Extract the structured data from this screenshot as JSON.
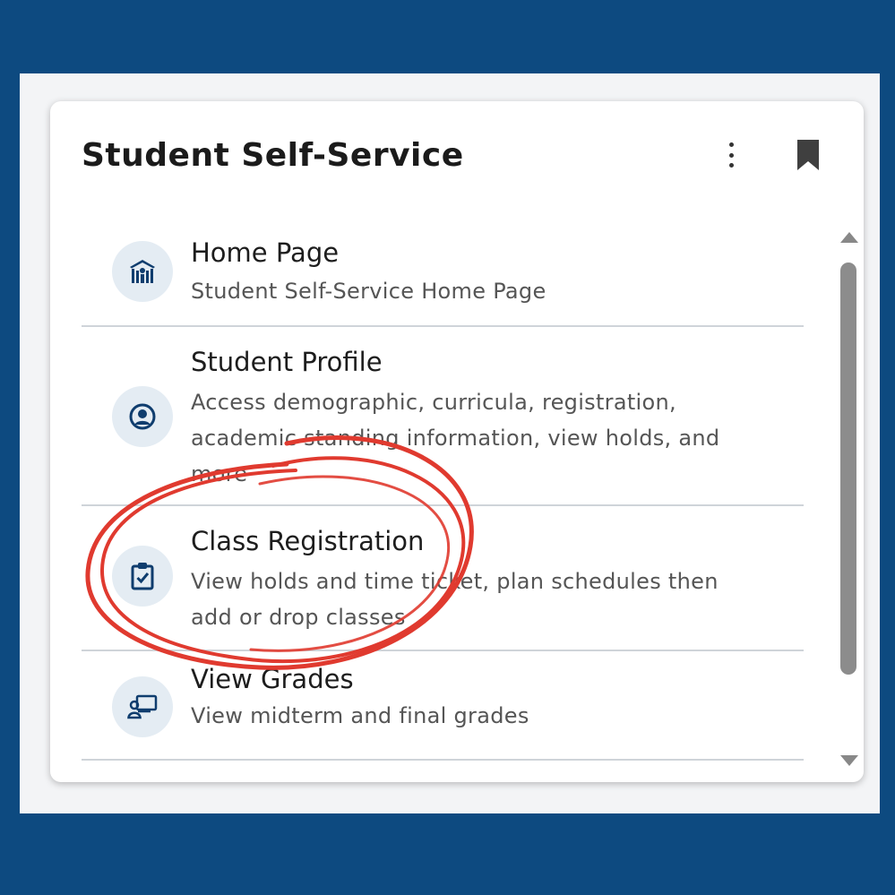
{
  "card": {
    "title": "Student Self-Service"
  },
  "items": [
    {
      "title": "Home Page",
      "description": "Student Self-Service Home Page",
      "icon": "school-building-icon"
    },
    {
      "title": "Student Profile",
      "description": "Access demographic, curricula, registration, academic standing information, view holds, and more",
      "icon": "person-circle-icon"
    },
    {
      "title": "Class Registration",
      "description": "View holds and time ticket, plan schedules then add or drop classes",
      "icon": "clipboard-check-icon"
    },
    {
      "title": "View Grades",
      "description": "View midterm and final grades",
      "icon": "teacher-board-icon"
    }
  ],
  "colors": {
    "background": "#0d4a80",
    "icon_fill": "#0f3d6e",
    "annotation": "#e03a2f"
  }
}
